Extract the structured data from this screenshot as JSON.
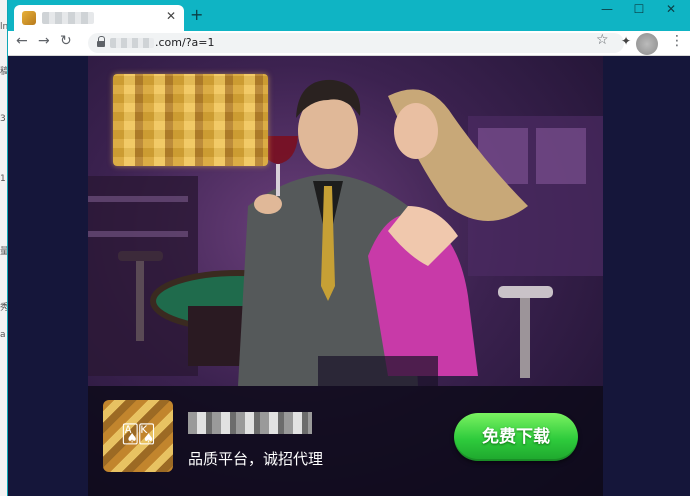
{
  "window": {
    "tab_title": "",
    "new_tab": "+",
    "tab_close": "✕",
    "controls": {
      "minimize": "—",
      "maximize": "☐",
      "close": "✕"
    }
  },
  "toolbar": {
    "back": "←",
    "forward": "→",
    "reload": "↻",
    "url_visible": ".com/?a=1",
    "bookmark": "☆",
    "menu": "⋮"
  },
  "ad": {
    "tagline": "品质平台，诚招代理",
    "download_label": "免费下载",
    "button_color": "#2ecb3c"
  },
  "colors": {
    "tabbar": "#0fb4c4",
    "page_bg": "#15163a"
  }
}
